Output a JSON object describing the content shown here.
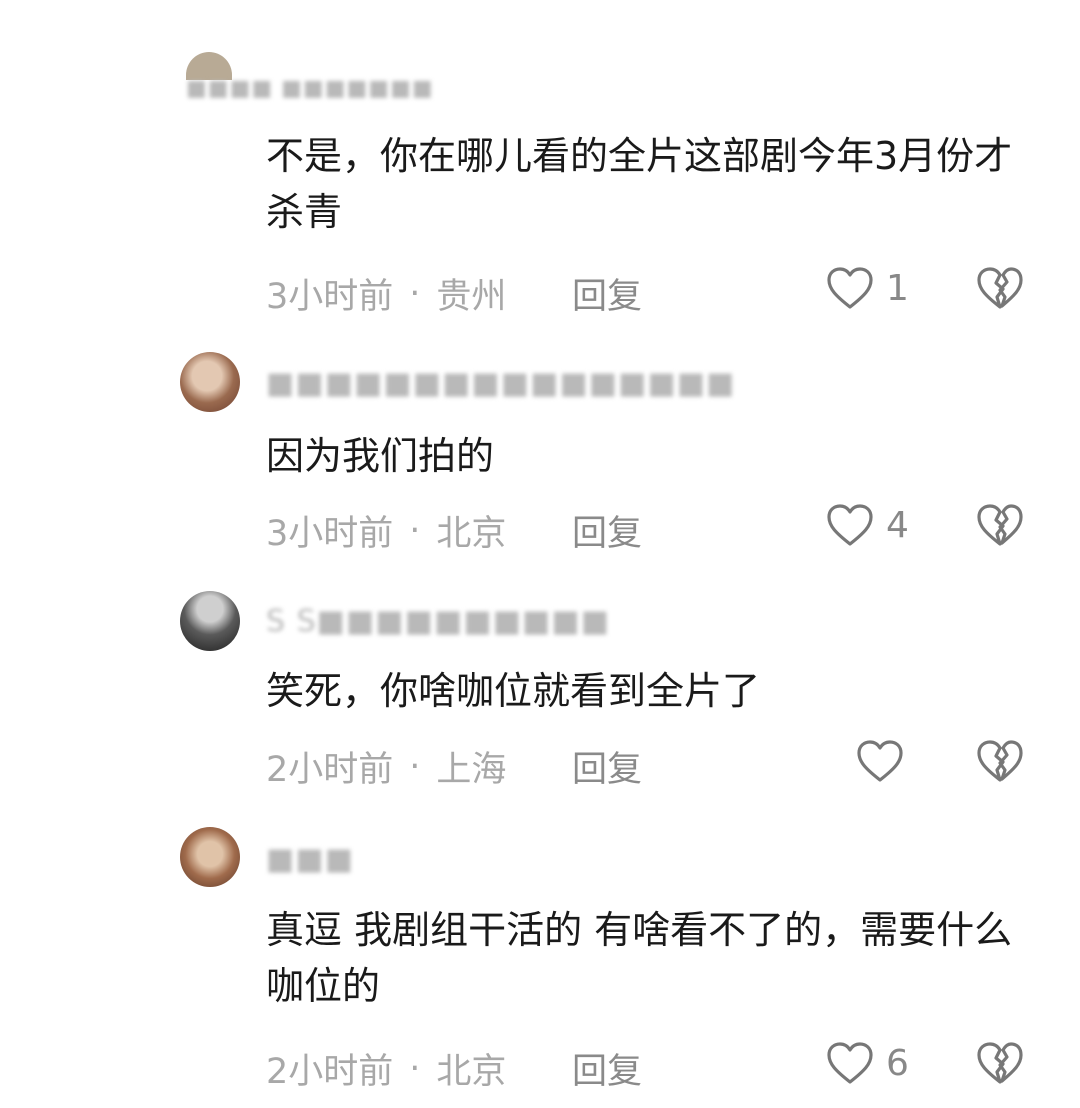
{
  "comments": [
    {
      "username": "■■■■ ■■■■■■■",
      "text": "不是，你在哪儿看的全片这部剧今年3月份才杀青",
      "time": "3小时前",
      "location": "贵州",
      "reply": "回复",
      "likes": "1"
    },
    {
      "username": "■■■■■■■■■■■■■■■■",
      "text": "因为我们拍的",
      "time": "3小时前",
      "location": "北京",
      "reply": "回复",
      "likes": "4"
    },
    {
      "username": "S S■■■■■■■■■■",
      "text": "笑死，你啥咖位就看到全片了",
      "time": "2小时前",
      "location": "上海",
      "reply": "回复",
      "likes": ""
    },
    {
      "username": "■■■",
      "text": "真逗 我剧组干活的 有啥看不了的，需要什么咖位的",
      "time": "2小时前",
      "location": "北京",
      "reply": "回复",
      "likes": "6"
    }
  ],
  "separator": "·",
  "icons": {
    "like": "heart-icon",
    "dislike": "broken-heart-icon"
  }
}
